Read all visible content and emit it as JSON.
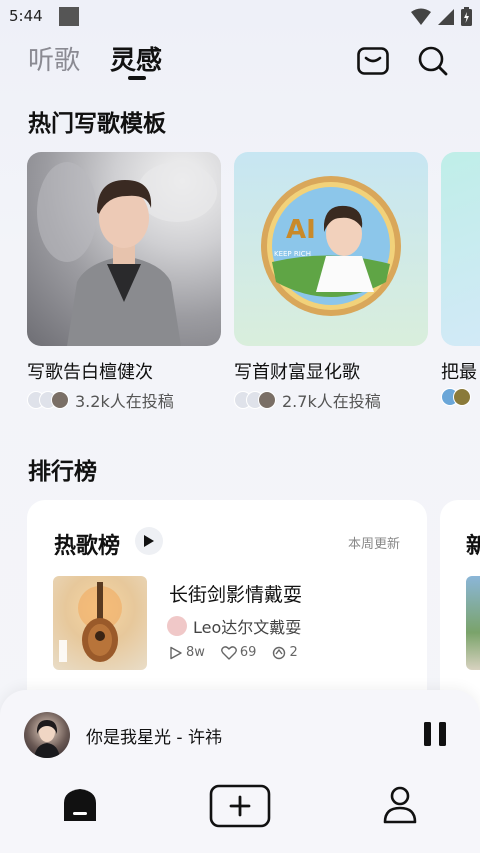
{
  "status_bar": {
    "time": "5:44"
  },
  "nav": {
    "tabs": [
      "听歌",
      "灵感"
    ],
    "active_tab": 1
  },
  "sections": {
    "templates_title": "热门写歌模板",
    "charts_title": "排行榜"
  },
  "templates": [
    {
      "name": "写歌告白檀健次",
      "count": "3.2k人在投稿"
    },
    {
      "name": "写首财富显化歌",
      "count": "2.7k人在投稿"
    },
    {
      "name": "把最"
    }
  ],
  "chart": {
    "title": "热歌榜",
    "update": "本周更新",
    "song": {
      "title": "长街剑影情戴耍",
      "artist": "Leo达尔文戴耍",
      "plays": "8w",
      "likes": "69",
      "remixes": "2"
    }
  },
  "next_board_title": "新",
  "player": {
    "title": "你是我星光 - 许祎"
  },
  "badge_text": "KEEP RICH",
  "colors": {
    "accent": "#111111",
    "background": "#f3f4f9"
  }
}
